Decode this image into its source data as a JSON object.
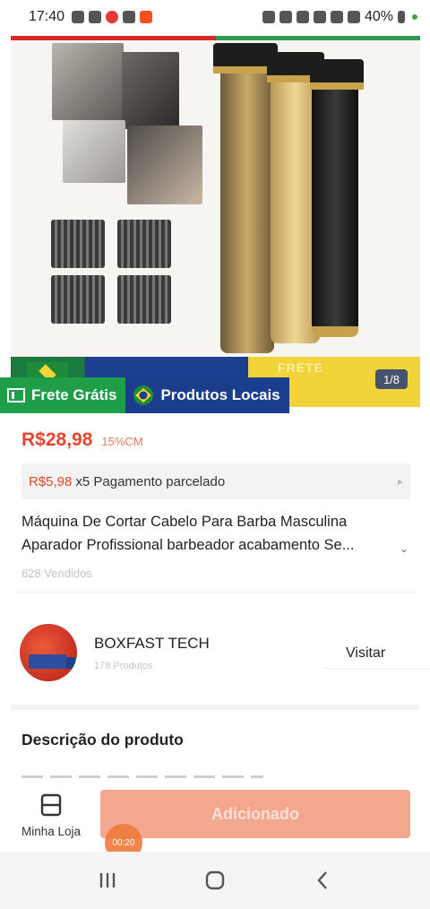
{
  "status_bar": {
    "time": "17:40",
    "battery": "40%"
  },
  "gallery": {
    "counter": "1/8",
    "banner_text": "FRETE"
  },
  "badges": {
    "free_shipping": "Frete Grátis",
    "local_products": "Produtos Locais"
  },
  "price": {
    "value": "R$28,98",
    "discount": "15%CM"
  },
  "installment": {
    "amount": "R$5,98",
    "text": "x5 Pagamento parcelado"
  },
  "product": {
    "title_line1": "Máquina De Cortar Cabelo Para Barba Masculina",
    "title_line2": "Aparador Profissional barbeador acabamento Se...",
    "sold": "628 Vendidos"
  },
  "store": {
    "name": "BOXFAST TECH",
    "products": "178 Produtos",
    "visit_label": "Visitar"
  },
  "description": {
    "title": "Descrição do produto"
  },
  "bottom": {
    "store_tab_label": "Minha Loja",
    "add_label": "Adicionado",
    "timer": "00:20"
  },
  "colors": {
    "price": "#e8452c",
    "green_badge": "#1f9e4a",
    "blue_badge": "#1a3e8c",
    "add_button": "#f4a78f"
  }
}
